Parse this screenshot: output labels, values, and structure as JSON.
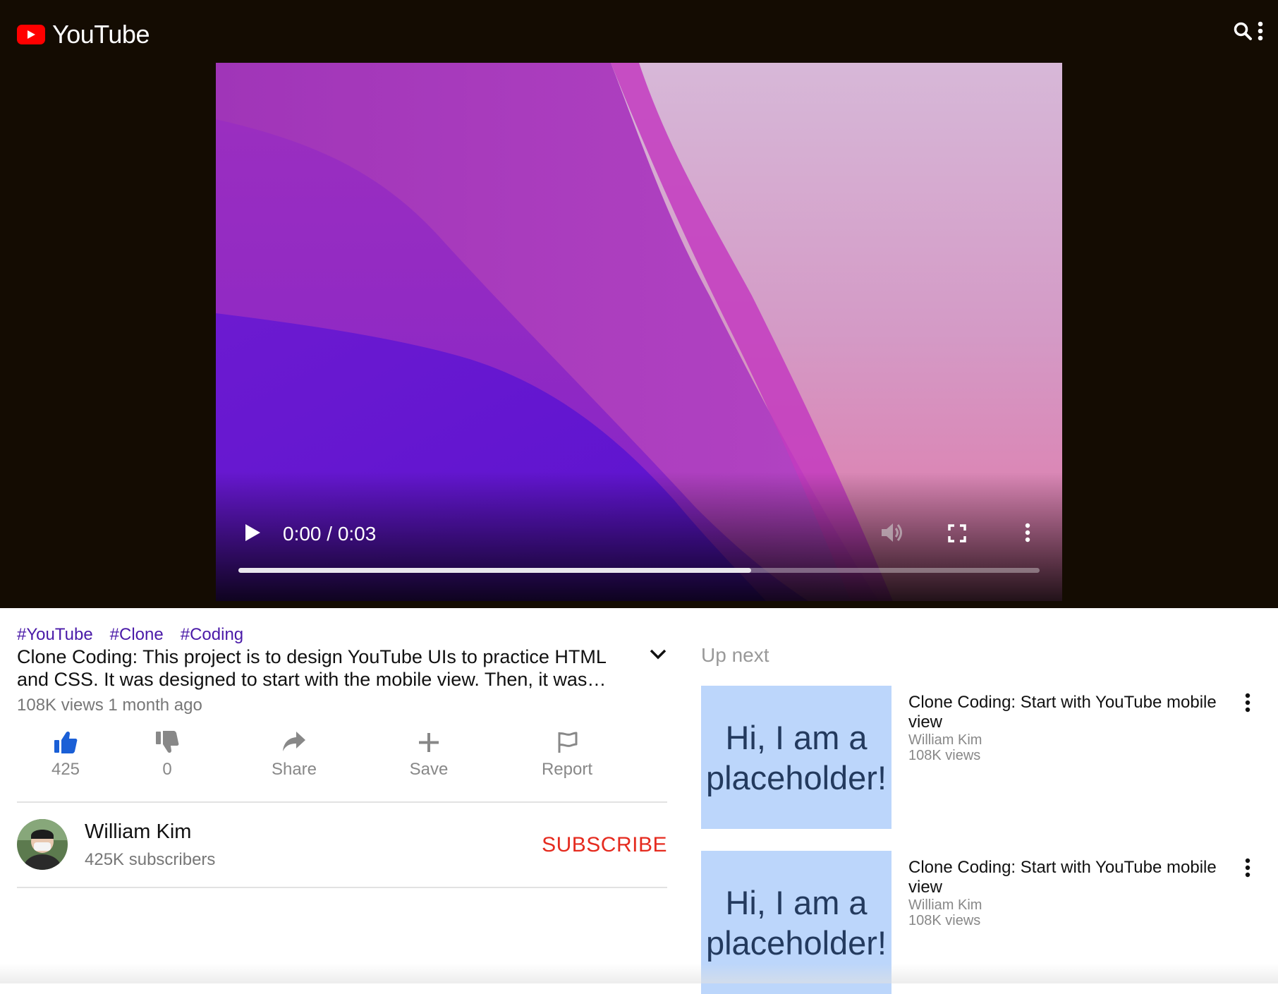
{
  "header": {
    "logo_text": "YouTube",
    "icons": [
      "youtube-logo-icon",
      "search-icon",
      "more-vert-icon"
    ]
  },
  "player": {
    "time": "0:00 / 0:03",
    "progress_fraction": 0.64,
    "controls": [
      "play-icon",
      "volume-icon",
      "fullscreen-icon",
      "more-vert-icon"
    ]
  },
  "video": {
    "tags": [
      "#YouTube",
      "#Clone",
      "#Coding"
    ],
    "title": "Clone Coding: This project is to design YouTube UIs to practice HTML and CSS. It was designed to start with the mobile view. Then, it was converted for desktop view.",
    "meta": "108K views 1 month ago"
  },
  "actions": {
    "like": "425",
    "dislike": "0",
    "share": "Share",
    "save": "Save",
    "report": "Report"
  },
  "channel": {
    "name": "William Kim",
    "subscribers": "425K subscribers",
    "subscribe_label": "SUBSCRIBE"
  },
  "upnext": {
    "label": "Up next",
    "items": [
      {
        "thumbnail_text": "Hi, I am a placeholder!",
        "title": "Clone Coding: Start with YouTube mobile view",
        "channel": "William Kim",
        "views": "108K views"
      },
      {
        "thumbnail_text": "Hi, I am a placeholder!",
        "title": "Clone Coding: Start with YouTube mobile view",
        "channel": "William Kim",
        "views": "108K views"
      }
    ]
  },
  "colors": {
    "header_bg": "#140c02",
    "brand_red": "#ff0000",
    "like_blue": "#1a5fd6",
    "tag_purple": "#4a1aa8",
    "subscribe_red": "#e52b1f",
    "thumbnail_bg": "#bcd6fb"
  }
}
